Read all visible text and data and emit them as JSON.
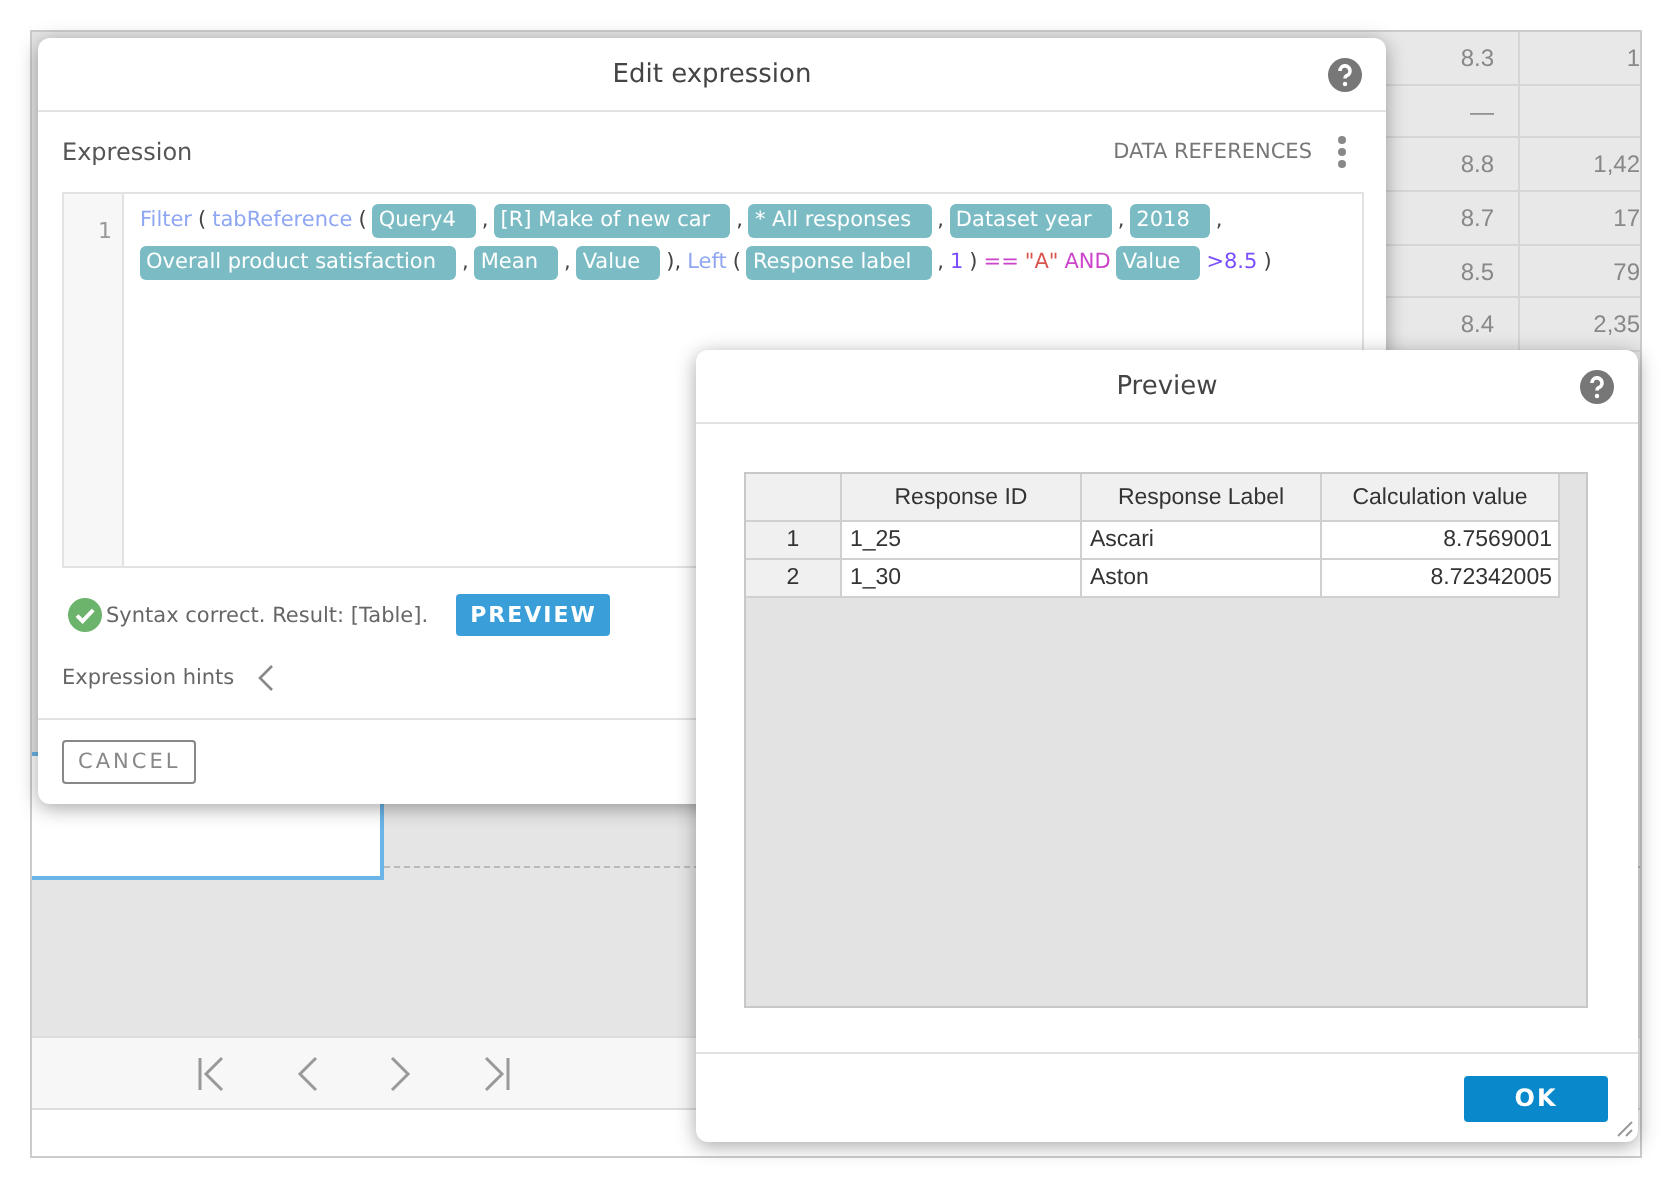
{
  "background_table": {
    "rows": [
      {
        "column_1": "8.3",
        "column_2": "1"
      },
      {
        "column_1": "—"
      },
      {
        "column_1": "8.8",
        "column_2": "1,42"
      },
      {
        "column_1": "8.7",
        "column_2": "17"
      },
      {
        "column_1": "8.5",
        "column_2": "79"
      },
      {
        "column_1": "8.4",
        "column_2": "2,35"
      }
    ]
  },
  "edit_dialog": {
    "title": "Edit expression",
    "section_label": "Expression",
    "data_references": "DATA REFERENCES",
    "editor": {
      "line_number": "1",
      "tokens": [
        {
          "kind": "func",
          "text": "Filter"
        },
        {
          "kind": "punct",
          "text": "("
        },
        {
          "kind": "func",
          "text": "tabReference"
        },
        {
          "kind": "punct",
          "text": "("
        },
        {
          "kind": "ref",
          "text": "Query4"
        },
        {
          "kind": "punct",
          "text": ","
        },
        {
          "kind": "ref",
          "text": "[R] Make of new car"
        },
        {
          "kind": "punct",
          "text": ","
        },
        {
          "kind": "ref",
          "text": "* All responses"
        },
        {
          "kind": "punct",
          "text": ","
        },
        {
          "kind": "ref",
          "text": "Dataset year"
        },
        {
          "kind": "punct",
          "text": ","
        },
        {
          "kind": "ref",
          "text": "2018"
        },
        {
          "kind": "punct",
          "text": ","
        },
        {
          "kind": "ref",
          "text": "Overall product satisfaction"
        },
        {
          "kind": "punct",
          "text": ","
        },
        {
          "kind": "ref",
          "text": "Mean"
        },
        {
          "kind": "punct",
          "text": ","
        },
        {
          "kind": "ref",
          "text": "Value"
        },
        {
          "kind": "punct",
          "text": "),"
        },
        {
          "kind": "func",
          "text": "Left"
        },
        {
          "kind": "punct",
          "text": "("
        },
        {
          "kind": "ref",
          "text": "Response label"
        },
        {
          "kind": "punct",
          "text": ","
        },
        {
          "kind": "num",
          "text": "1"
        },
        {
          "kind": "punct",
          "text": ")"
        },
        {
          "kind": "op",
          "text": "=="
        },
        {
          "kind": "string",
          "text": "\"A\""
        },
        {
          "kind": "op",
          "text": "AND"
        },
        {
          "kind": "ref",
          "text": "Value"
        },
        {
          "kind": "num",
          "text": ">8.5"
        },
        {
          "kind": "punct",
          "text": ")"
        }
      ]
    },
    "status": {
      "valid": true,
      "text": "Syntax correct. Result: [Table]."
    },
    "preview_button": "PREVIEW",
    "hints_label": "Expression hints",
    "cancel_button": "CANCEL"
  },
  "preview_dialog": {
    "title": "Preview",
    "table": {
      "columns": [
        "Response ID",
        "Response Label",
        "Calculation value"
      ],
      "rows": [
        {
          "number": "1",
          "cells": [
            "1_25",
            "Ascari",
            "8.7569001"
          ]
        },
        {
          "number": "2",
          "cells": [
            "1_30",
            "Aston",
            "8.72342005"
          ]
        }
      ]
    },
    "ok_button": "OK"
  }
}
